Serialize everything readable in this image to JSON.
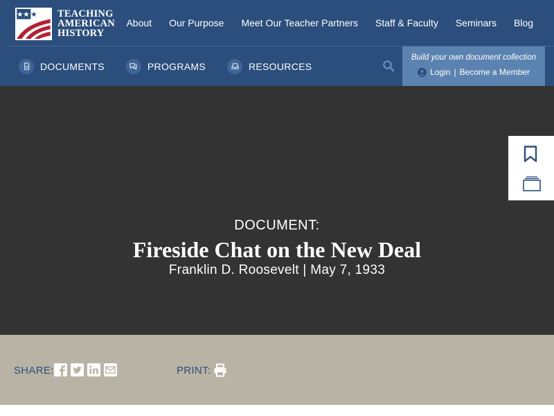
{
  "brand": {
    "line1": "TEACHING",
    "line2": "AMERICAN",
    "line3": "HISTORY"
  },
  "topnav": {
    "items": [
      "About",
      "Our Purpose",
      "Meet Our Teacher Partners",
      "Staff & Faculty",
      "Seminars",
      "Blog"
    ]
  },
  "subnav": {
    "items": [
      {
        "label": "DOCUMENTS",
        "icon": "document-icon"
      },
      {
        "label": "PROGRAMS",
        "icon": "chat-icon"
      },
      {
        "label": "RESOURCES",
        "icon": "inbox-icon"
      }
    ],
    "search_icon": "search-icon"
  },
  "member": {
    "tagline": "Build your own document collection",
    "login": "Login",
    "separator": "|",
    "become": "Become a Member"
  },
  "hero": {
    "label": "DOCUMENT:",
    "title": "Fireside Chat on the New Deal",
    "subtitle": "Franklin D. Roosevelt | May 7, 1933"
  },
  "side_tools": {
    "bookmark_icon": "bookmark-icon",
    "collection_icon": "collection-icon"
  },
  "share": {
    "label": "SHARE:",
    "icons": [
      "facebook-icon",
      "twitter-icon",
      "linkedin-icon",
      "email-icon"
    ],
    "print_label": "PRINT:",
    "print_icon": "print-icon"
  },
  "colors": {
    "header": "#2b4e7c",
    "member_box": "#5b83b1",
    "hero": "#333333",
    "share_bar": "#b8b3a4",
    "accent_text": "#2b4e7c"
  }
}
